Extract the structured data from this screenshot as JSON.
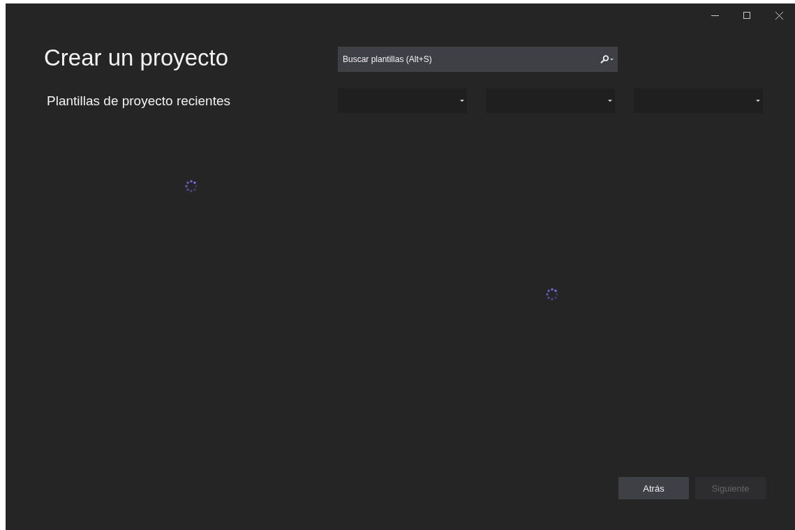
{
  "window": {
    "controls": [
      {
        "kind": "minimize"
      },
      {
        "kind": "maximize"
      },
      {
        "kind": "close"
      }
    ]
  },
  "title": "Crear un proyecto",
  "search": {
    "placeholder": "Buscar plantillas (Alt+S)"
  },
  "recent": {
    "heading": "Plantillas de proyecto recientes",
    "loading": true
  },
  "filters": [
    {
      "kind": "dropdown"
    },
    {
      "kind": "dropdown"
    },
    {
      "kind": "dropdown"
    }
  ],
  "templates": {
    "loading": true
  },
  "buttons": [
    {
      "label": "Atrás",
      "disabled": false
    },
    {
      "label": "Siguiente",
      "disabled": true
    }
  ]
}
